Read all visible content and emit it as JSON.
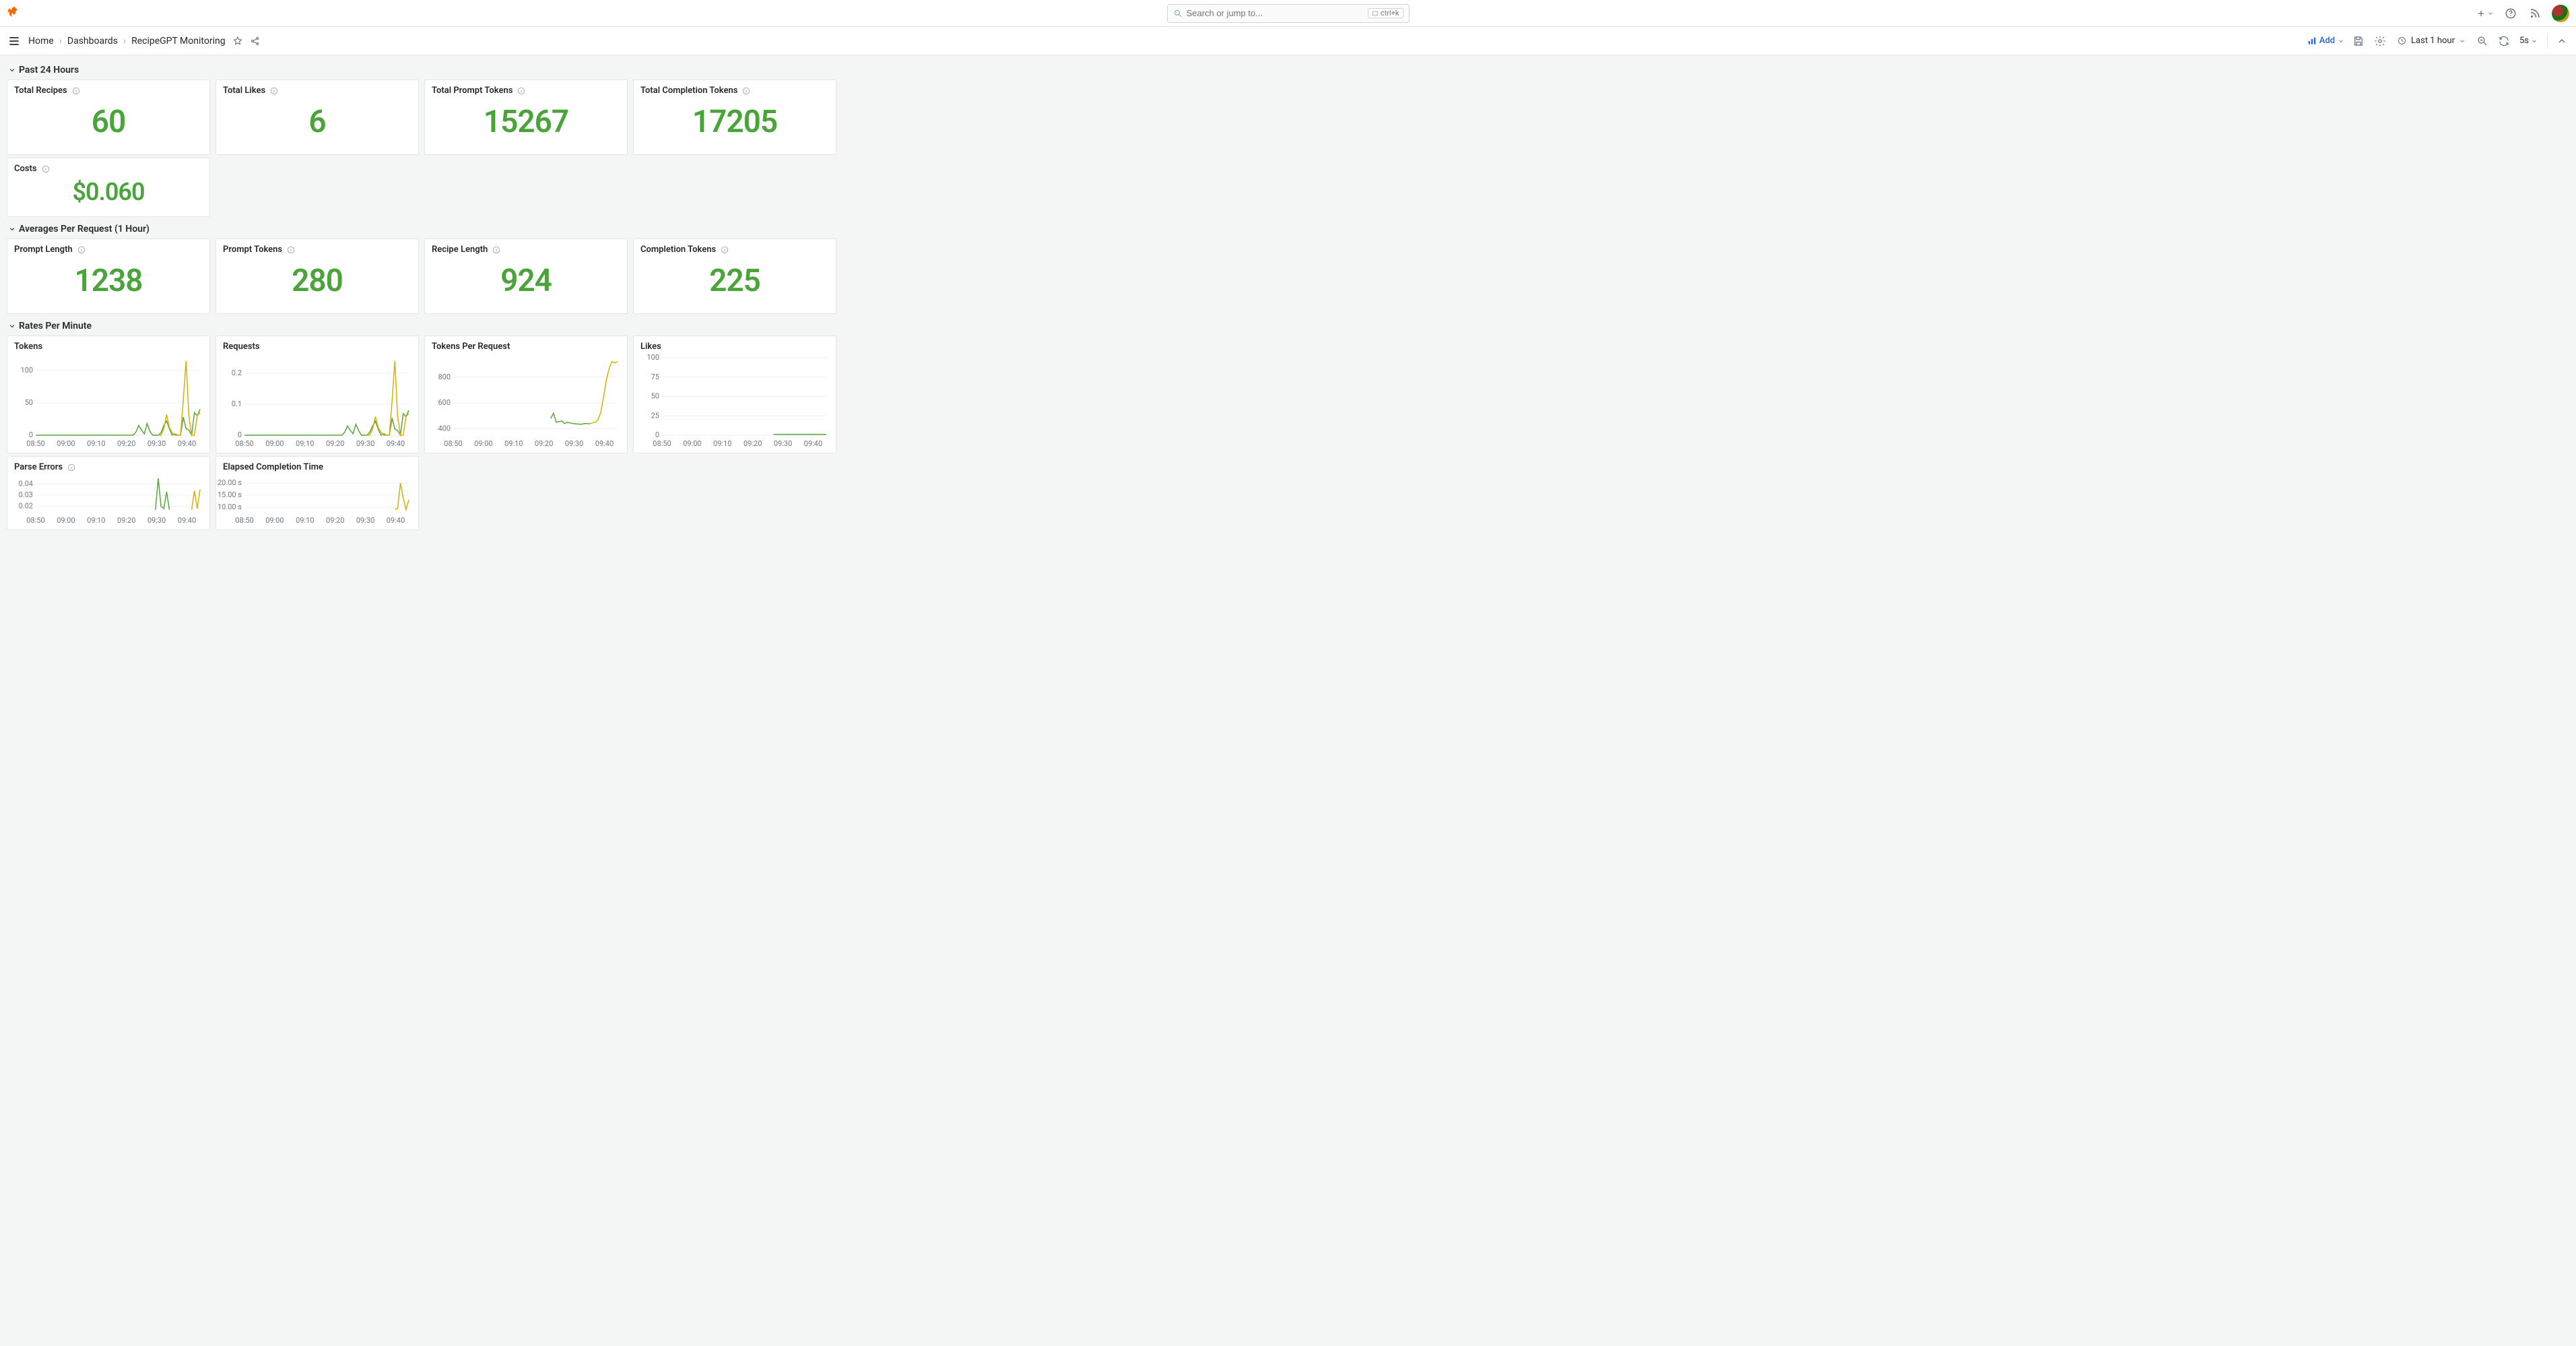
{
  "search": {
    "placeholder": "Search or jump to...",
    "shortcut": "ctrl+k"
  },
  "breadcrumbs": [
    "Home",
    "Dashboards",
    "RecipeGPT Monitoring"
  ],
  "toolbar": {
    "add_label": "Add",
    "timerange_label": "Last 1 hour",
    "refresh_interval": "5s"
  },
  "sections": {
    "s1": {
      "title": "Past 24 Hours"
    },
    "s2": {
      "title": "Averages Per Request (1 Hour)"
    },
    "s3": {
      "title": "Rates Per Minute"
    }
  },
  "stats": {
    "total_recipes": {
      "title": "Total Recipes",
      "value": "60"
    },
    "total_likes": {
      "title": "Total Likes",
      "value": "6"
    },
    "total_prompt_tokens": {
      "title": "Total Prompt Tokens",
      "value": "15267"
    },
    "total_completion_tokens": {
      "title": "Total Completion Tokens",
      "value": "17205"
    },
    "costs": {
      "title": "Costs",
      "value": "$0.060"
    },
    "prompt_length": {
      "title": "Prompt Length",
      "value": "1238"
    },
    "prompt_tokens": {
      "title": "Prompt Tokens",
      "value": "280"
    },
    "recipe_length": {
      "title": "Recipe Length",
      "value": "924"
    },
    "completion_tokens": {
      "title": "Completion Tokens",
      "value": "225"
    }
  },
  "charts": {
    "tokens": {
      "title": "Tokens"
    },
    "requests": {
      "title": "Requests"
    },
    "tokens_per_request": {
      "title": "Tokens Per Request"
    },
    "likes": {
      "title": "Likes"
    },
    "parse_errors": {
      "title": "Parse Errors"
    },
    "elapsed": {
      "title": "Elapsed Completion Time"
    }
  },
  "chart_data": [
    {
      "id": "tokens",
      "type": "line",
      "title": "Tokens",
      "xlabel": "",
      "ylabel": "",
      "x_ticks": [
        "08:50",
        "09:00",
        "09:10",
        "09:20",
        "09:30",
        "09:40"
      ],
      "y_ticks": [
        0,
        50,
        100
      ],
      "ylim": [
        0,
        120
      ],
      "series": [
        {
          "name": "green",
          "color": "#5aa43a",
          "x": [
            0,
            5,
            10,
            15,
            20,
            25,
            30,
            35,
            36,
            37,
            38,
            39,
            40,
            41,
            42,
            43,
            44,
            45,
            46,
            47,
            48,
            49,
            50,
            51,
            52,
            53,
            54,
            55,
            56,
            57,
            58,
            59
          ],
          "y": [
            0,
            0,
            0,
            0,
            0,
            0,
            0,
            0,
            5,
            15,
            8,
            2,
            18,
            6,
            0,
            0,
            0,
            4,
            15,
            22,
            10,
            0,
            2,
            0,
            0,
            28,
            10,
            8,
            0,
            35,
            30,
            40
          ]
        },
        {
          "name": "yellow",
          "color": "#d4b106",
          "x": [
            44,
            45,
            46,
            47,
            48,
            49,
            50,
            51,
            52,
            53,
            54,
            55,
            56,
            57,
            58,
            59
          ],
          "y": [
            0,
            0,
            10,
            32,
            12,
            4,
            0,
            0,
            0,
            55,
            115,
            30,
            0,
            0,
            30,
            35
          ]
        }
      ]
    },
    {
      "id": "requests",
      "type": "line",
      "title": "Requests",
      "x_ticks": [
        "08:50",
        "09:00",
        "09:10",
        "09:20",
        "09:30",
        "09:40"
      ],
      "y_ticks": [
        0,
        0.1,
        0.2
      ],
      "ylim": [
        0,
        0.25
      ],
      "series": [
        {
          "name": "green",
          "color": "#5aa43a",
          "x": [
            0,
            5,
            10,
            15,
            20,
            25,
            30,
            35,
            36,
            37,
            38,
            39,
            40,
            41,
            42,
            43,
            44,
            45,
            46,
            47,
            48,
            49,
            50,
            51,
            52,
            53,
            54,
            55,
            56,
            57,
            58,
            59
          ],
          "y": [
            0,
            0,
            0,
            0,
            0,
            0,
            0,
            0,
            0.01,
            0.03,
            0.015,
            0.005,
            0.035,
            0.015,
            0,
            0,
            0,
            0.01,
            0.03,
            0.045,
            0.02,
            0,
            0.005,
            0,
            0,
            0.055,
            0.02,
            0.015,
            0,
            0.07,
            0.06,
            0.08
          ]
        },
        {
          "name": "yellow",
          "color": "#d4b106",
          "x": [
            44,
            45,
            46,
            47,
            48,
            49,
            50,
            51,
            52,
            53,
            54,
            55,
            56,
            57,
            58,
            59
          ],
          "y": [
            0,
            0,
            0.02,
            0.06,
            0.025,
            0.01,
            0,
            0,
            0,
            0.11,
            0.24,
            0.06,
            0,
            0,
            0.06,
            0.07
          ]
        }
      ]
    },
    {
      "id": "tokens_per_request",
      "type": "line",
      "title": "Tokens Per Request",
      "x_ticks": [
        "08:50",
        "09:00",
        "09:10",
        "09:20",
        "09:30",
        "09:40"
      ],
      "y_ticks": [
        400,
        600,
        800
      ],
      "ylim": [
        350,
        950
      ],
      "series": [
        {
          "name": "green",
          "color": "#5aa43a",
          "x": [
            35,
            36,
            37,
            38,
            39,
            40,
            41,
            42,
            43,
            44,
            45,
            46,
            47,
            48,
            49
          ],
          "y": [
            480,
            520,
            450,
            455,
            460,
            440,
            450,
            445,
            440,
            438,
            436,
            435,
            440,
            440,
            438
          ]
        },
        {
          "name": "yellow",
          "color": "#d4b106",
          "x": [
            49,
            50,
            51,
            52,
            53,
            54,
            55,
            56,
            57,
            58,
            59
          ],
          "y": [
            440,
            445,
            450,
            470,
            530,
            650,
            780,
            870,
            920,
            910,
            920
          ]
        }
      ]
    },
    {
      "id": "likes",
      "type": "line",
      "title": "Likes",
      "x_ticks": [
        "08:50",
        "09:00",
        "09:10",
        "09:20",
        "09:30",
        "09:40"
      ],
      "y_ticks": [
        0,
        25,
        50,
        75,
        100
      ],
      "ylim": [
        0,
        100
      ],
      "series": [
        {
          "name": "green",
          "color": "#5aa43a",
          "x": [
            40,
            45,
            50,
            55,
            59
          ],
          "y": [
            1,
            1,
            1,
            1,
            1
          ]
        }
      ]
    },
    {
      "id": "parse_errors",
      "type": "line",
      "title": "Parse Errors",
      "x_ticks": [
        "08:50",
        "09:00",
        "09:10",
        "09:20",
        "09:30",
        "09:40"
      ],
      "y_ticks": [
        0.02,
        0.03,
        0.04
      ],
      "ylim": [
        0.015,
        0.045
      ],
      "series": [
        {
          "name": "green",
          "color": "#5aa43a",
          "x": [
            43,
            44,
            45,
            46,
            47,
            48
          ],
          "y": [
            0.017,
            0.045,
            0.02,
            0.018,
            0.033,
            0.017
          ]
        },
        {
          "name": "yellow",
          "color": "#d4b106",
          "x": [
            56,
            57,
            58,
            59
          ],
          "y": [
            0.017,
            0.034,
            0.018,
            0.035
          ]
        }
      ]
    },
    {
      "id": "elapsed",
      "type": "line",
      "title": "Elapsed Completion Time",
      "x_ticks": [
        "08:50",
        "09:00",
        "09:10",
        "09:20",
        "09:30",
        "09:40"
      ],
      "y_ticks": [
        "10.00 s",
        "15.00 s",
        "20.00 s"
      ],
      "y_tick_vals": [
        10,
        15,
        20
      ],
      "ylim": [
        8,
        22
      ],
      "series": [
        {
          "name": "yellow",
          "color": "#d4b106",
          "x": [
            54,
            55,
            56,
            57,
            58,
            59
          ],
          "y": [
            9,
            9.5,
            20,
            14,
            9,
            13
          ]
        }
      ]
    }
  ]
}
